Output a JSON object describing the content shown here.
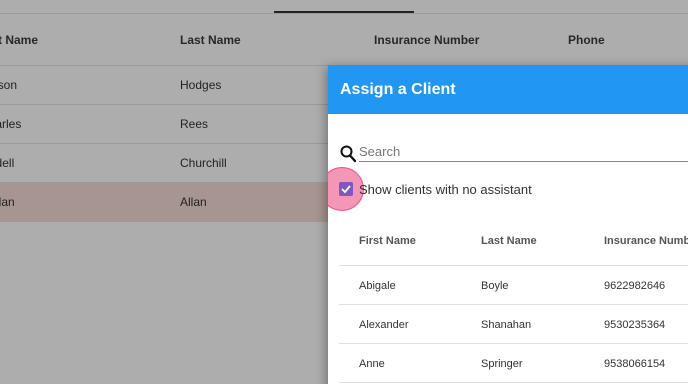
{
  "background_table": {
    "columns": [
      "First Name",
      "Last Name",
      "Insurance Number",
      "Phone"
    ],
    "rows": [
      {
        "first": "Jason",
        "last": "Hodges"
      },
      {
        "first": "Charles",
        "last": "Rees"
      },
      {
        "first": "Wardell",
        "last": "Churchill"
      },
      {
        "first": "Allan",
        "last": "Allan"
      }
    ]
  },
  "dialog": {
    "title": "Assign a Client",
    "search_placeholder": "Search",
    "checkbox_label": "Show clients with no assistant",
    "checkbox_checked": true,
    "columns": [
      "First Name",
      "Last Name",
      "Insurance Number"
    ],
    "rows": [
      {
        "first": "Abigale",
        "last": "Boyle",
        "insurance": "9622982646"
      },
      {
        "first": "Alexander",
        "last": "Shanahan",
        "insurance": "9530235364"
      },
      {
        "first": "Anne",
        "last": "Springer",
        "insurance": "9538066154"
      }
    ]
  },
  "colors": {
    "dialog_header": "#2196f3",
    "checkbox": "#7e57c2",
    "ripple": "#ec407a",
    "selected_row": "#f6dcd8"
  },
  "icons": [
    "search-icon",
    "check-icon"
  ]
}
